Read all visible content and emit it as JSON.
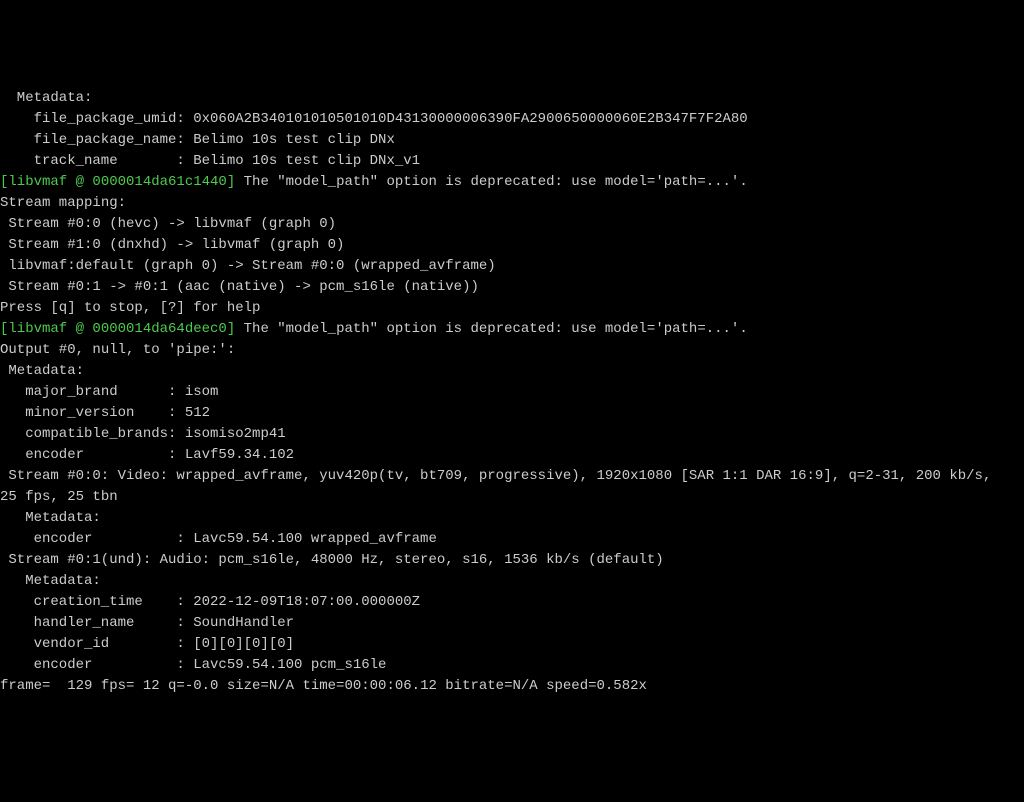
{
  "lines": [
    {
      "indent": 2,
      "spans": [
        {
          "text": "Metadata:"
        }
      ]
    },
    {
      "indent": 4,
      "spans": [
        {
          "text": "file_package_umid: 0x060A2B340101010501010D43130000006390FA2900650000060E2B347F7F2A80"
        }
      ]
    },
    {
      "indent": 4,
      "spans": [
        {
          "text": "file_package_name: Belimo 10s test clip DNx"
        }
      ]
    },
    {
      "indent": 4,
      "spans": [
        {
          "text": "track_name       : Belimo 10s test clip DNx_v1"
        }
      ]
    },
    {
      "indent": 0,
      "spans": [
        {
          "text": "[libvmaf @ 0000014da61c1440]",
          "class": "green"
        },
        {
          "text": " The \"model_path\" option is deprecated: use model='path=...'."
        }
      ]
    },
    {
      "indent": 0,
      "spans": [
        {
          "text": "Stream mapping:"
        }
      ]
    },
    {
      "indent": 1,
      "spans": [
        {
          "text": "Stream #0:0 (hevc) -> libvmaf (graph 0)"
        }
      ]
    },
    {
      "indent": 1,
      "spans": [
        {
          "text": "Stream #1:0 (dnxhd) -> libvmaf (graph 0)"
        }
      ]
    },
    {
      "indent": 1,
      "spans": [
        {
          "text": "libvmaf:default (graph 0) -> Stream #0:0 (wrapped_avframe)"
        }
      ]
    },
    {
      "indent": 1,
      "spans": [
        {
          "text": "Stream #0:1 -> #0:1 (aac (native) -> pcm_s16le (native))"
        }
      ]
    },
    {
      "indent": 0,
      "spans": [
        {
          "text": "Press [q] to stop, [?] for help"
        }
      ]
    },
    {
      "indent": 0,
      "spans": [
        {
          "text": "[libvmaf @ 0000014da64deec0]",
          "class": "green"
        },
        {
          "text": " The \"model_path\" option is deprecated: use model='path=...'."
        }
      ]
    },
    {
      "indent": 0,
      "spans": [
        {
          "text": "Output #0, null, to 'pipe:':"
        }
      ]
    },
    {
      "indent": 1,
      "spans": [
        {
          "text": "Metadata:"
        }
      ]
    },
    {
      "indent": 3,
      "spans": [
        {
          "text": "major_brand      : isom"
        }
      ]
    },
    {
      "indent": 3,
      "spans": [
        {
          "text": "minor_version    : 512"
        }
      ]
    },
    {
      "indent": 3,
      "spans": [
        {
          "text": "compatible_brands: isomiso2mp41"
        }
      ]
    },
    {
      "indent": 3,
      "spans": [
        {
          "text": "encoder          : Lavf59.34.102"
        }
      ]
    },
    {
      "indent": 1,
      "spans": [
        {
          "text": "Stream #0:0: Video: wrapped_avframe, yuv420p(tv, bt709, progressive), 1920x1080 [SAR 1:1 DAR 16:9], q=2-31, 200 kb/s,"
        }
      ]
    },
    {
      "indent": 0,
      "spans": [
        {
          "text": "25 fps, 25 tbn"
        }
      ]
    },
    {
      "indent": 3,
      "spans": [
        {
          "text": "Metadata:"
        }
      ]
    },
    {
      "indent": 4,
      "spans": [
        {
          "text": "encoder          : Lavc59.54.100 wrapped_avframe"
        }
      ]
    },
    {
      "indent": 1,
      "spans": [
        {
          "text": "Stream #0:1(und): Audio: pcm_s16le, 48000 Hz, stereo, s16, 1536 kb/s (default)"
        }
      ]
    },
    {
      "indent": 3,
      "spans": [
        {
          "text": "Metadata:"
        }
      ]
    },
    {
      "indent": 4,
      "spans": [
        {
          "text": "creation_time    : 2022-12-09T18:07:00.000000Z"
        }
      ]
    },
    {
      "indent": 4,
      "spans": [
        {
          "text": "handler_name     : SoundHandler"
        }
      ]
    },
    {
      "indent": 4,
      "spans": [
        {
          "text": "vendor_id        : [0][0][0][0]"
        }
      ]
    },
    {
      "indent": 4,
      "spans": [
        {
          "text": "encoder          : Lavc59.54.100 pcm_s16le"
        }
      ]
    },
    {
      "indent": 0,
      "spans": [
        {
          "text": "frame=  129 fps= 12 q=-0.0 size=N/A time=00:00:06.12 bitrate=N/A speed=0.582x"
        }
      ]
    }
  ]
}
